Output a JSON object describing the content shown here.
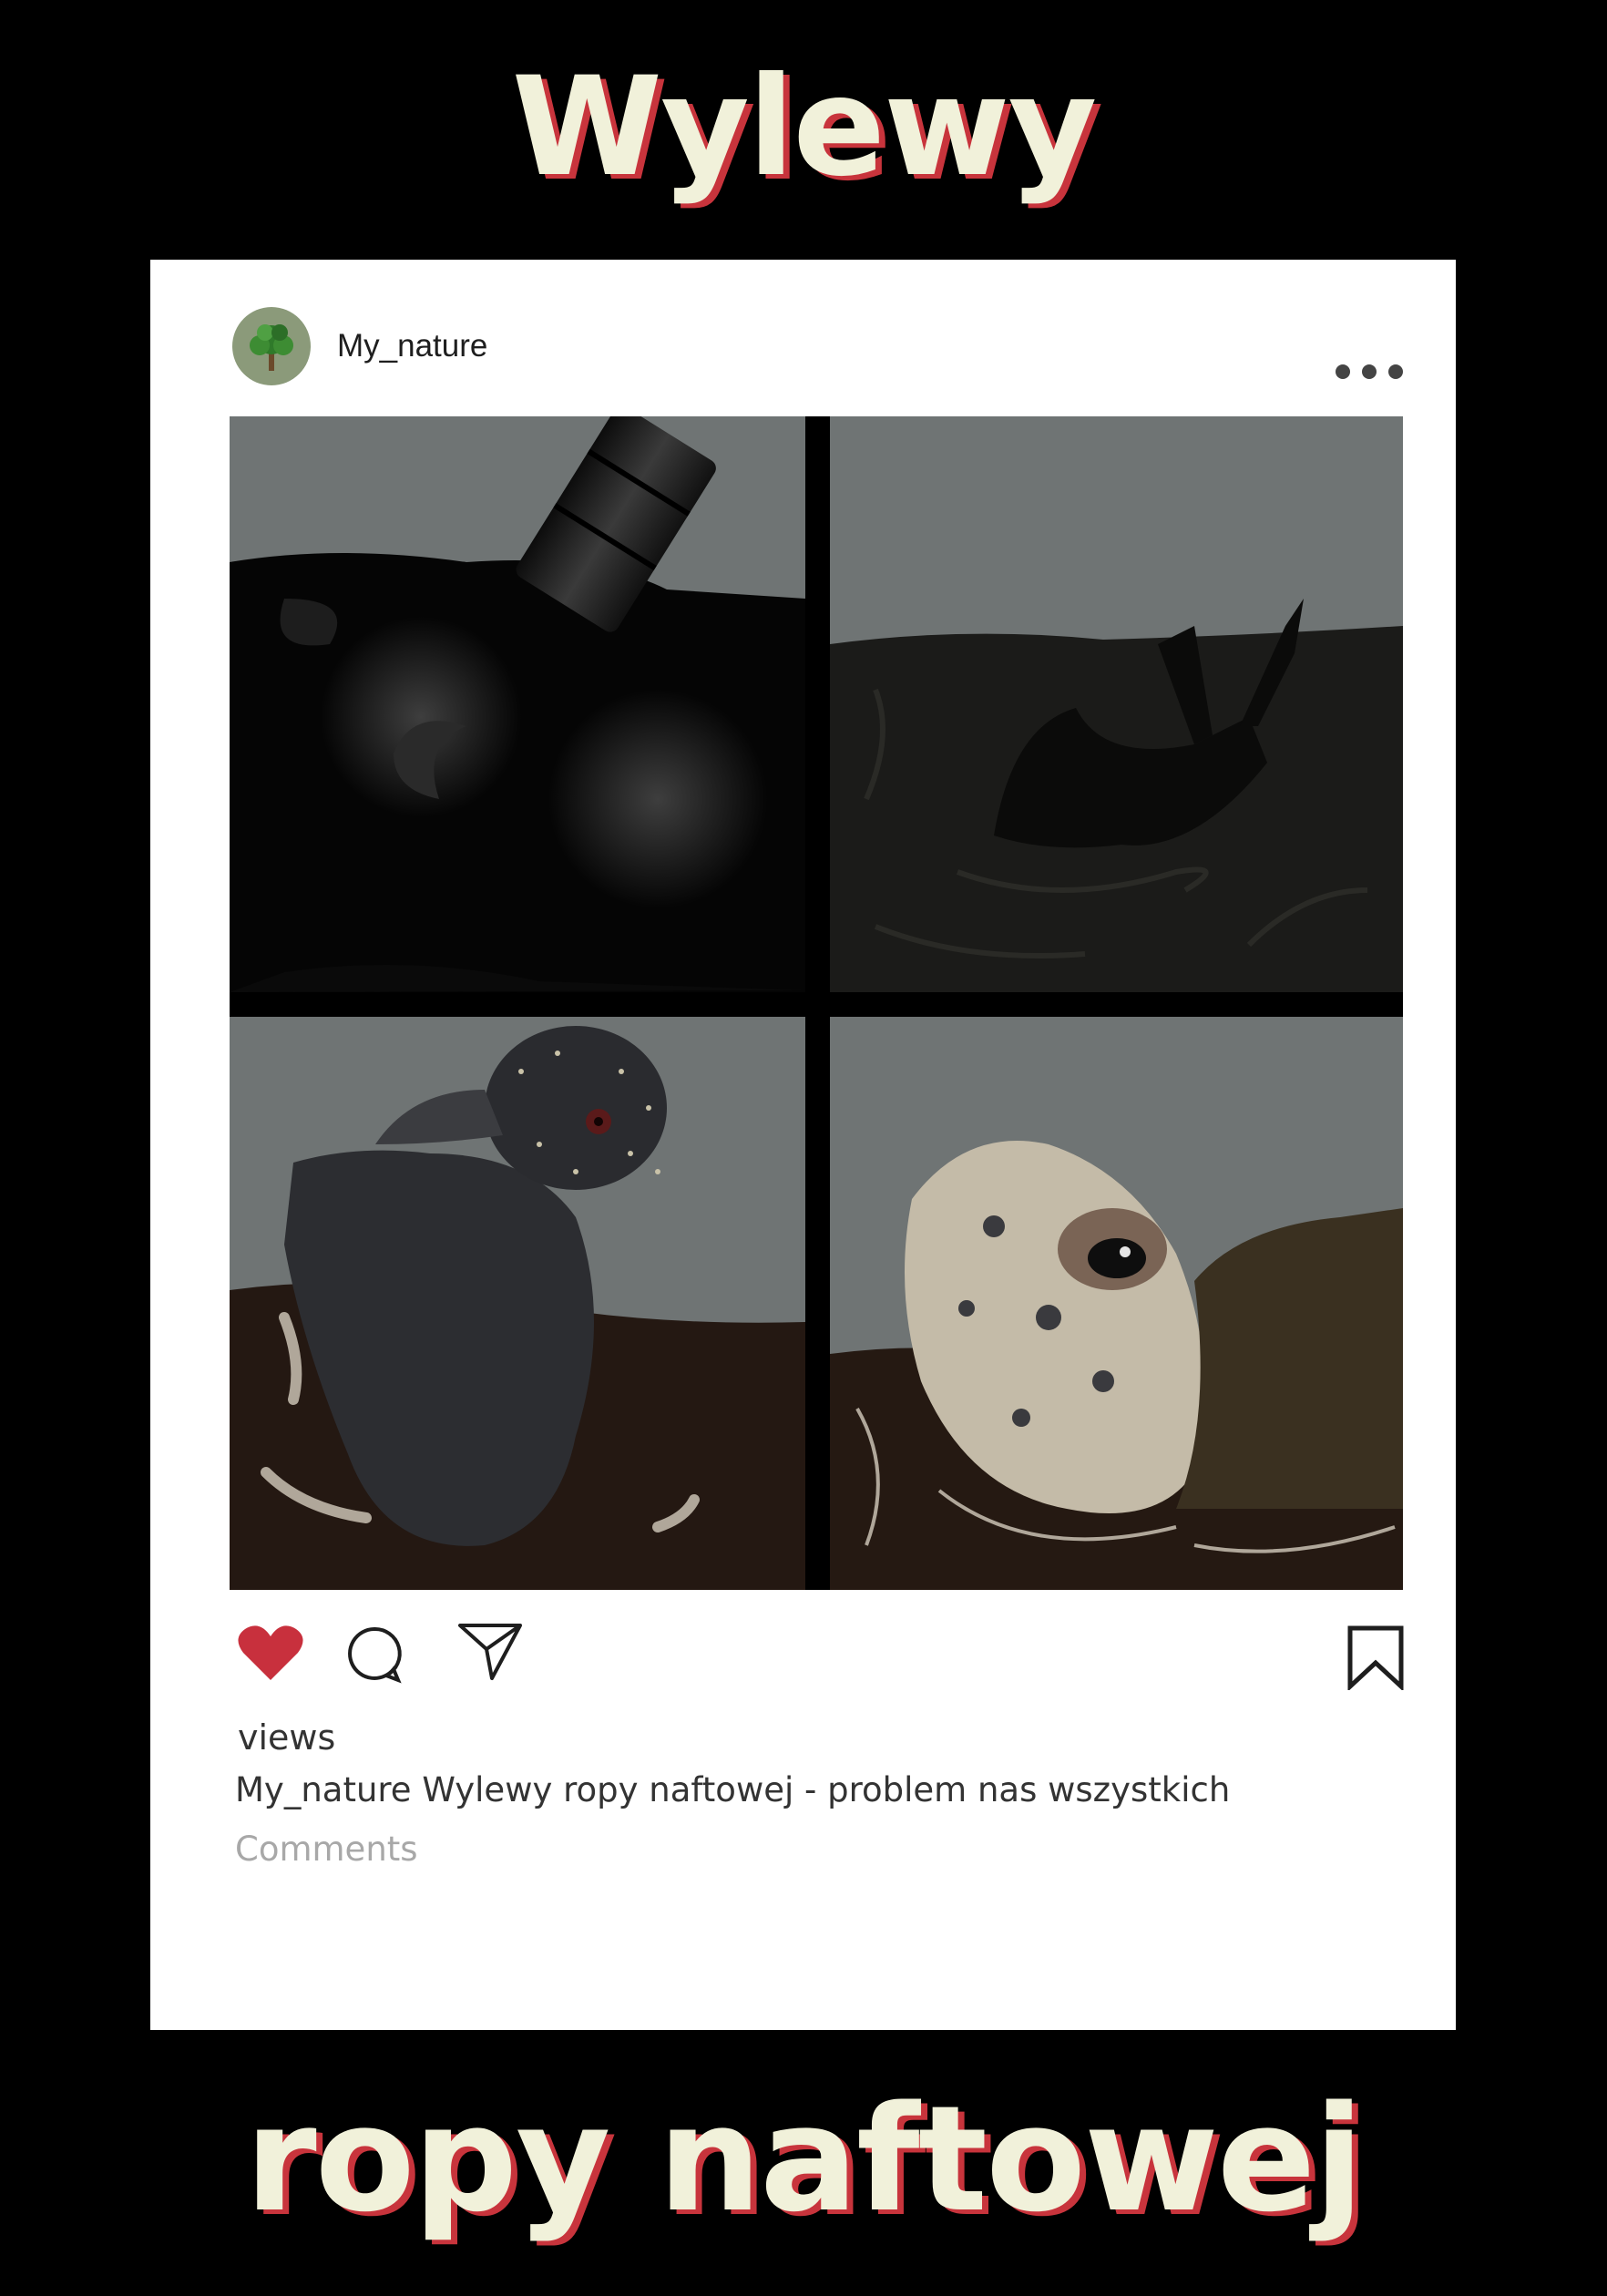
{
  "poster": {
    "title_top": "Wylewy",
    "title_bottom": "ropy naftowej"
  },
  "post": {
    "username": "My_nature",
    "avatar_icon": "tree-icon",
    "menu_icon": "more-options-icon",
    "views_label": "views",
    "caption": "My_nature Wylewy ropy naftowej - problem nas wszystkich",
    "comments_label": "Comments",
    "liked": true,
    "like_color": "#c8303d"
  },
  "actions": [
    {
      "name": "like",
      "icon": "heart-icon"
    },
    {
      "name": "comment",
      "icon": "speech-bubble-icon"
    },
    {
      "name": "share",
      "icon": "paper-plane-icon"
    },
    {
      "name": "save",
      "icon": "bookmark-icon"
    }
  ],
  "colors": {
    "background": "#000000",
    "title_text": "#f1f1da",
    "title_shadow": "#c8343c",
    "card": "#ffffff"
  }
}
